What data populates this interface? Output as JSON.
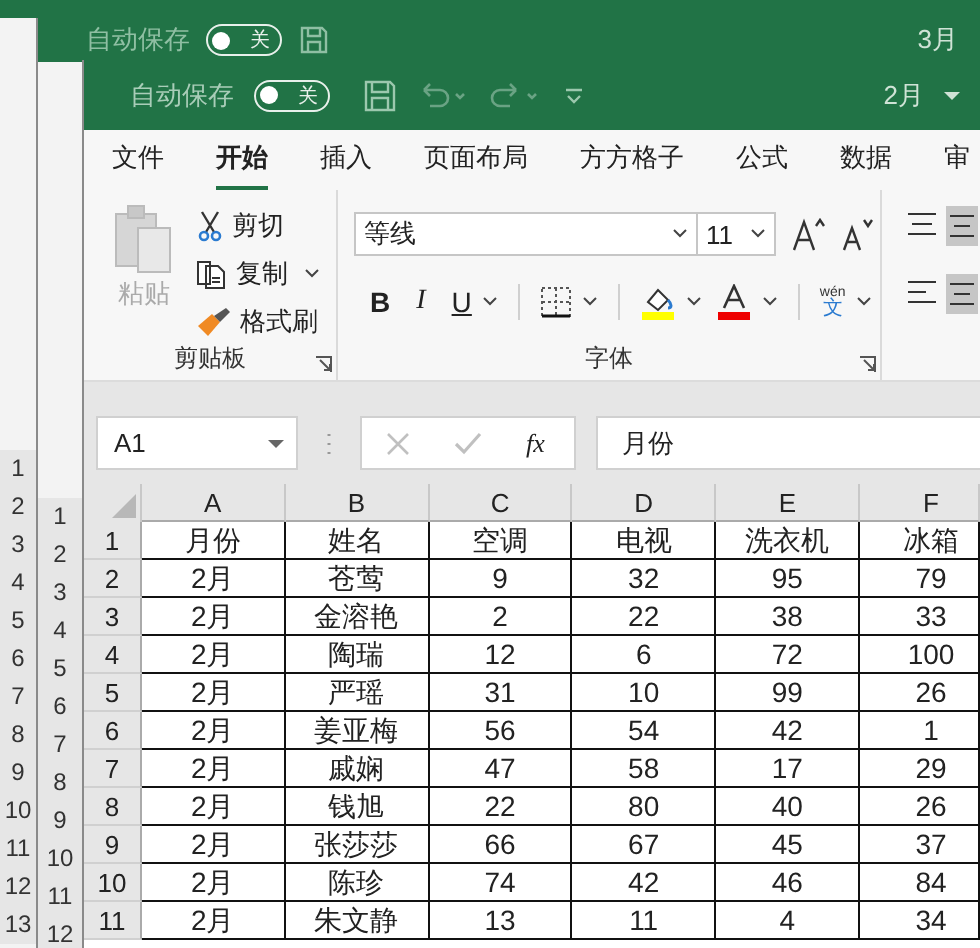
{
  "back_windows": [
    {
      "row_numbers": [
        "1",
        "2",
        "3",
        "4",
        "5",
        "6",
        "7",
        "8",
        "9",
        "10",
        "11",
        "12",
        "13"
      ]
    },
    {
      "title": "3月",
      "autosave_label": "自动保存",
      "autosave_on": false,
      "autosave_state": "关",
      "row_numbers": [
        "1",
        "2",
        "3",
        "4",
        "5",
        "6",
        "7",
        "8",
        "9",
        "10",
        "11",
        "12"
      ]
    }
  ],
  "window": {
    "title": "2月",
    "autosave_label": "自动保存",
    "autosave_on": false,
    "autosave_state": "关"
  },
  "tabs": [
    {
      "label": "文件",
      "selected": false
    },
    {
      "label": "开始",
      "selected": true
    },
    {
      "label": "插入",
      "selected": false
    },
    {
      "label": "页面布局",
      "selected": false
    },
    {
      "label": "方方格子",
      "selected": false
    },
    {
      "label": "公式",
      "selected": false
    },
    {
      "label": "数据",
      "selected": false
    },
    {
      "label": "审",
      "selected": false
    }
  ],
  "clipboard": {
    "paste": {
      "label": "粘贴",
      "disabled": true
    },
    "cut": "剪切",
    "copy": "复制",
    "format_painter": "格式刷",
    "group_label": "剪贴板"
  },
  "font": {
    "name": "等线",
    "size": "11",
    "bold": "B",
    "italic": "I",
    "underline": "U",
    "phonetic": "wén",
    "phonetic_char": "文",
    "group_label": "字体"
  },
  "formula_bar": {
    "name_box": "A1",
    "confirm_disabled": true,
    "function_label": "fx",
    "value": "月份"
  },
  "sheet": {
    "columns": [
      "A",
      "B",
      "C",
      "D",
      "E",
      "F"
    ],
    "rows": [
      {
        "number": "1",
        "cells": [
          "月份",
          "姓名",
          "空调",
          "电视",
          "洗衣机",
          "冰箱"
        ]
      },
      {
        "number": "2",
        "cells": [
          "2月",
          "苍莺",
          "9",
          "32",
          "95",
          "79"
        ]
      },
      {
        "number": "3",
        "cells": [
          "2月",
          "金溶艳",
          "2",
          "22",
          "38",
          "33"
        ]
      },
      {
        "number": "4",
        "cells": [
          "2月",
          "陶瑞",
          "12",
          "6",
          "72",
          "100"
        ]
      },
      {
        "number": "5",
        "cells": [
          "2月",
          "严瑶",
          "31",
          "10",
          "99",
          "26"
        ]
      },
      {
        "number": "6",
        "cells": [
          "2月",
          "姜亚梅",
          "56",
          "54",
          "42",
          "1"
        ]
      },
      {
        "number": "7",
        "cells": [
          "2月",
          "戚娴",
          "47",
          "58",
          "17",
          "29"
        ]
      },
      {
        "number": "8",
        "cells": [
          "2月",
          "钱旭",
          "22",
          "80",
          "40",
          "26"
        ]
      },
      {
        "number": "9",
        "cells": [
          "2月",
          "张莎莎",
          "66",
          "67",
          "45",
          "37"
        ]
      },
      {
        "number": "10",
        "cells": [
          "2月",
          "陈珍",
          "74",
          "42",
          "46",
          "84"
        ]
      },
      {
        "number": "11",
        "cells": [
          "2月",
          "朱文静",
          "13",
          "11",
          "4",
          "34"
        ]
      }
    ]
  }
}
